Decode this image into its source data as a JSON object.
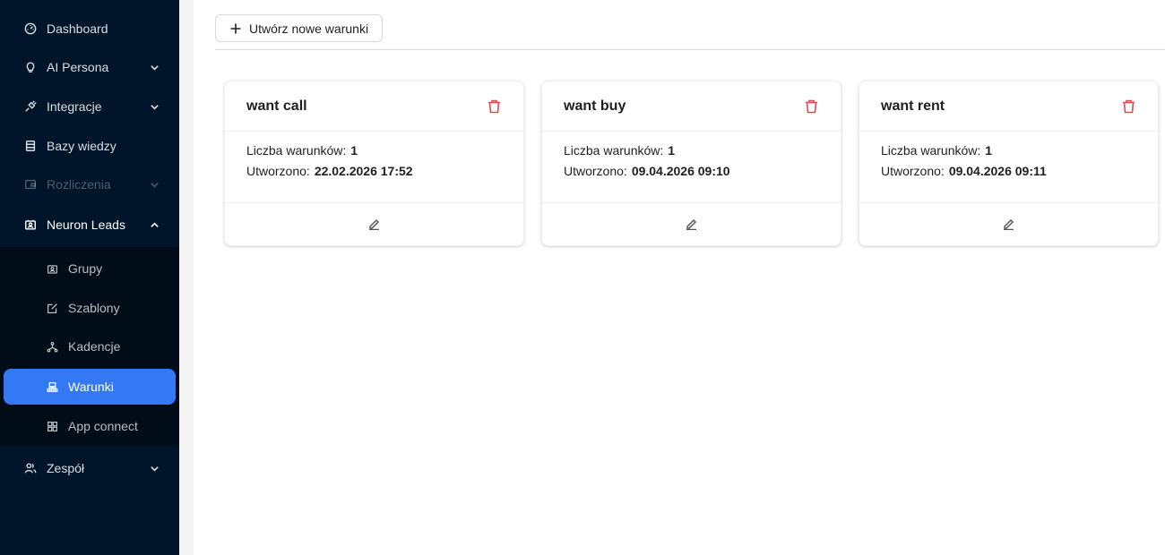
{
  "sidebar": {
    "items": [
      {
        "label": "Dashboard",
        "icon": "dashboard-icon"
      },
      {
        "label": "AI Persona",
        "icon": "bulb-icon"
      },
      {
        "label": "Integracje",
        "icon": "plug-icon"
      },
      {
        "label": "Bazy wiedzy",
        "icon": "database-icon"
      },
      {
        "label": "Rozliczenia",
        "icon": "wallet-icon"
      },
      {
        "label": "Neuron Leads",
        "icon": "contacts-icon"
      },
      {
        "label": "Zespół",
        "icon": "team-icon"
      }
    ],
    "submenu": [
      {
        "label": "Grupy",
        "icon": "contacts-icon"
      },
      {
        "label": "Szablony",
        "icon": "form-icon"
      },
      {
        "label": "Kadencje",
        "icon": "deployment-icon"
      },
      {
        "label": "Warunki",
        "icon": "cluster-icon"
      },
      {
        "label": "App connect",
        "icon": "appstore-icon"
      }
    ]
  },
  "toolbar": {
    "create_label": "Utwórz nowe warunki"
  },
  "cards": [
    {
      "title": "want call",
      "count_label": "Liczba warunków:",
      "count": "1",
      "created_label": "Utworzono:",
      "created": "22.02.2026 17:52"
    },
    {
      "title": "want buy",
      "count_label": "Liczba warunków:",
      "count": "1",
      "created_label": "Utworzono:",
      "created": "09.04.2026 09:10"
    },
    {
      "title": "want rent",
      "count_label": "Liczba warunków:",
      "count": "1",
      "created_label": "Utworzono:",
      "created": "09.04.2026 09:11"
    }
  ],
  "colors": {
    "sidebar_bg": "#001529",
    "submenu_bg": "#000c17",
    "selected": "#3478f6",
    "danger": "#e5484d"
  }
}
